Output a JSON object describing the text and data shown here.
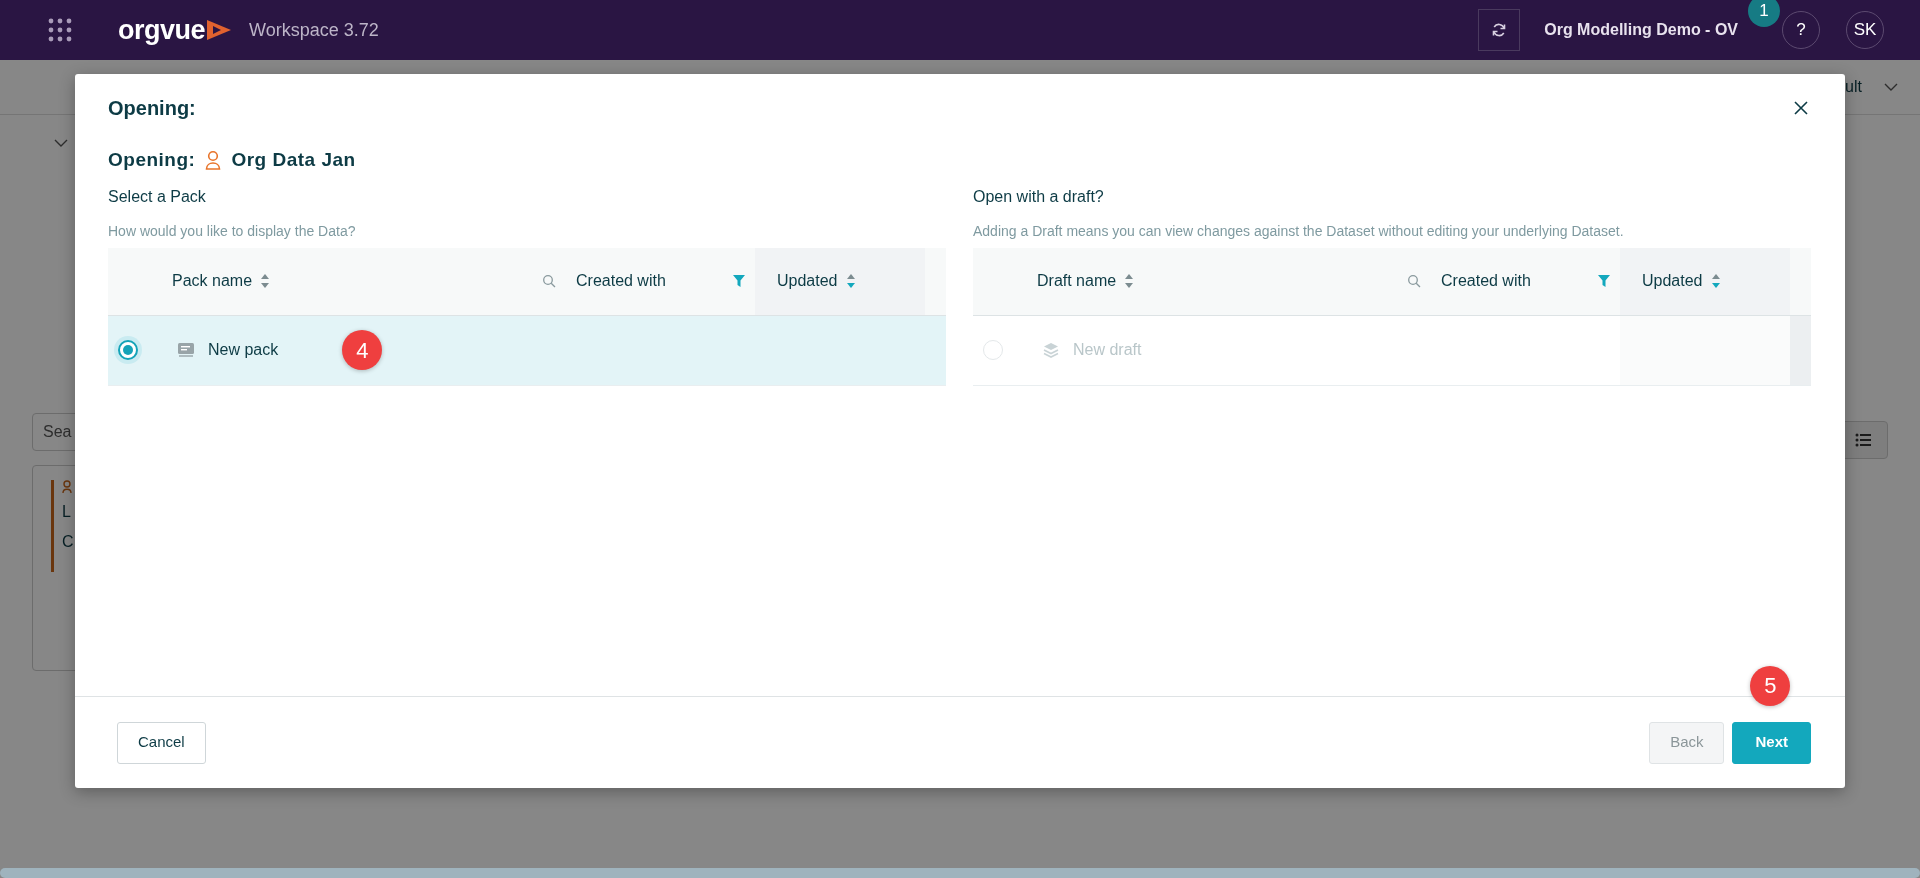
{
  "top_bar": {
    "app_name": "orgvue",
    "product": "Workspace",
    "version": "3.72",
    "workspace": "Org Modelling Demo - OV",
    "step_badge": "1",
    "help": "?",
    "user_initials": "SK"
  },
  "background": {
    "view_label": "ult",
    "search": {
      "value": "Sea"
    },
    "card_lines": [
      "L",
      "C"
    ]
  },
  "dialog": {
    "title": "Opening:",
    "subtitle_label": "Opening:",
    "dataset_name": "Org Data Jan",
    "panels": [
      {
        "heading": "Select a Pack",
        "hint": "How would you like to display the Data?",
        "disabled": false,
        "columns": [
          {
            "label": "Pack name",
            "kind": "name",
            "sorted_descending": false
          },
          {
            "label": "Created with",
            "kind": "filter"
          },
          {
            "label": "Updated",
            "kind": "sort",
            "sorted_descending": true
          }
        ],
        "rows": [
          {
            "name": "New pack",
            "selected": true,
            "step_badge": "4"
          }
        ]
      },
      {
        "heading": "Open with a draft?",
        "hint": "Adding a Draft means you can view changes against the Dataset without editing your underlying Dataset.",
        "disabled": true,
        "columns": [
          {
            "label": "Draft name",
            "kind": "name",
            "sorted_descending": false
          },
          {
            "label": "Created with",
            "kind": "filter"
          },
          {
            "label": "Updated",
            "kind": "sort",
            "sorted_descending": true
          }
        ],
        "rows": [
          {
            "name": "New draft",
            "selected": false
          }
        ]
      }
    ],
    "buttons": [
      {
        "label": "Cancel",
        "kind": "secondary",
        "disabled": false
      },
      {
        "label": "Back",
        "kind": "secondary",
        "disabled": true
      },
      {
        "label": "Next",
        "kind": "primary",
        "disabled": false,
        "step_badge": "5"
      }
    ]
  }
}
